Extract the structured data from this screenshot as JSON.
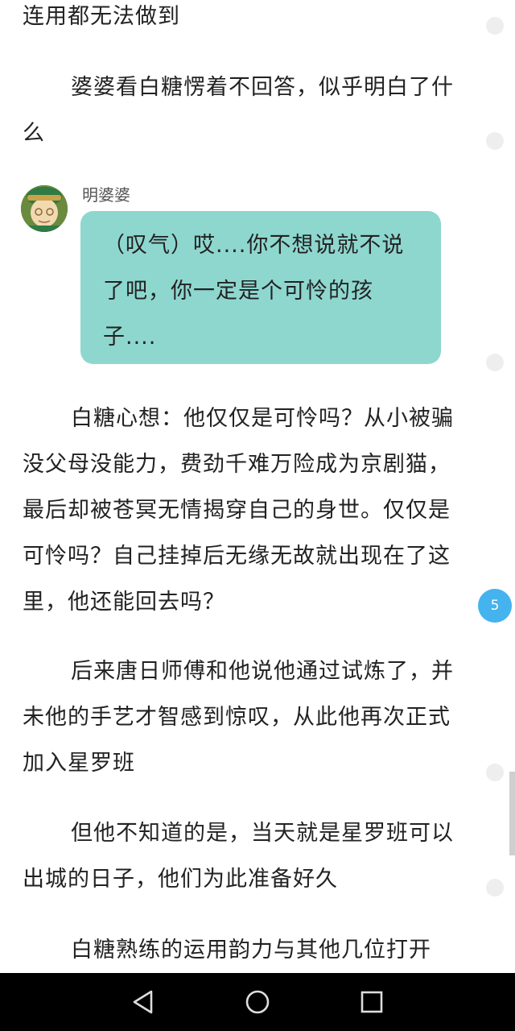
{
  "story": {
    "p1": "连用都无法做到",
    "p2": "婆婆看白糖愣着不回答，似乎明白了什么",
    "speaker_name": "明婆婆",
    "dialogue": "（叹气）哎....你不想说就不说了吧，你一定是个可怜的孩子....",
    "p3": "白糖心想：他仅仅是可怜吗？从小被骗没父母没能力，费劲千难万险成为京剧猫，最后却被苍冥无情揭穿自己的身世。仅仅是可怜吗？自己挂掉后无缘无故就出现在了这里，他还能回去吗？",
    "p4": "后来唐日师傅和他说他通过试炼了，并未他的手艺才智感到惊叹，从此他再次正式加入星罗班",
    "p5": "但他不知道的是，当天就是星罗班可以出城的日子，他们为此准备好久",
    "p6": "白糖熟练的运用韵力与其他几位打开"
  },
  "comments": {
    "count": "5"
  },
  "colors": {
    "bubble": "#8ed7cf",
    "badge": "#45b3ee",
    "navbar": "#000000"
  },
  "navbar": {
    "back_icon": "back-triangle-icon",
    "home_icon": "home-circle-icon",
    "recents_icon": "recents-square-icon"
  }
}
